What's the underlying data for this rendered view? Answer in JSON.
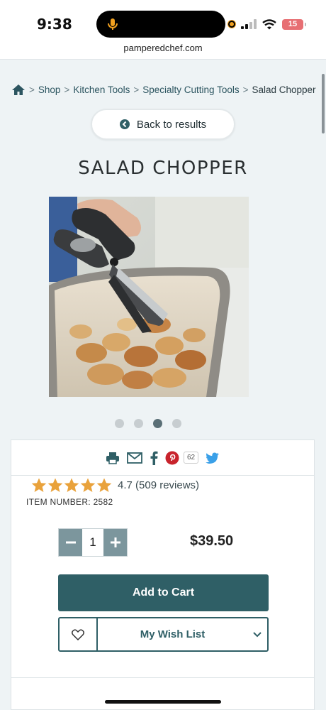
{
  "status": {
    "time": "9:38",
    "battery": "15"
  },
  "browser": {
    "url": "pamperedchef.com"
  },
  "breadcrumb": {
    "items": [
      "Shop",
      "Kitchen Tools",
      "Specialty Cutting Tools"
    ],
    "current": "Salad Chopper",
    "separator": ">"
  },
  "back_label": "Back to results",
  "product": {
    "title": "SALAD CHOPPER",
    "rating_text": "4.7 (509 reviews)",
    "rating_value": 4.7,
    "item_number": "ITEM NUMBER: 2582",
    "quantity": "1",
    "price": "$39.50",
    "add_to_cart": "Add to Cart",
    "wishlist_label": "My Wish List"
  },
  "carousel": {
    "count": 4,
    "active_index": 2
  },
  "share": {
    "pin_count": "62"
  },
  "colors": {
    "brand": "#2f5f66",
    "star": "#e9a23b",
    "qty_button": "#7c969d"
  }
}
